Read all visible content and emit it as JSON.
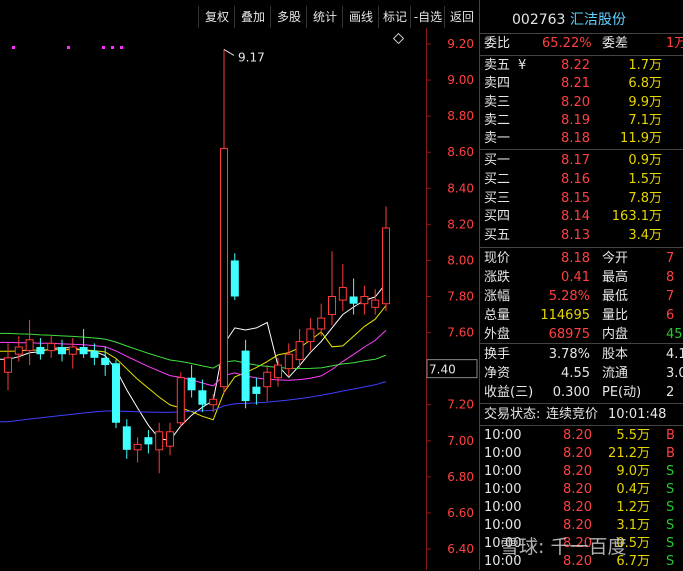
{
  "toolbar": {
    "buttons": [
      "复权",
      "叠加",
      "多股",
      "统计",
      "画线",
      "标记",
      "-自选",
      "返回"
    ]
  },
  "chart_data": {
    "type": "candlestick",
    "y_ticks": [
      "9.20",
      "9.00",
      "8.80",
      "8.60",
      "8.40",
      "8.20",
      "8.00",
      "7.80",
      "7.60",
      "7.40",
      "7.20",
      "7.00",
      "6.80",
      "6.60",
      "6.40"
    ],
    "ylim": [
      6.35,
      9.3
    ],
    "high_annotation": "9.17",
    "current_price_marker": "7.40",
    "candles": [
      {
        "o": 7.38,
        "c": 7.46,
        "h": 7.54,
        "l": 7.28,
        "up": true
      },
      {
        "o": 7.48,
        "c": 7.52,
        "h": 7.58,
        "l": 7.44,
        "up": true
      },
      {
        "o": 7.5,
        "c": 7.56,
        "h": 7.67,
        "l": 7.42,
        "up": true
      },
      {
        "o": 7.52,
        "c": 7.48,
        "h": 7.57,
        "l": 7.45,
        "up": false
      },
      {
        "o": 7.5,
        "c": 7.54,
        "h": 7.58,
        "l": 7.46,
        "up": true
      },
      {
        "o": 7.52,
        "c": 7.48,
        "h": 7.56,
        "l": 7.44,
        "up": false
      },
      {
        "o": 7.48,
        "c": 7.52,
        "h": 7.57,
        "l": 7.4,
        "up": true
      },
      {
        "o": 7.52,
        "c": 7.48,
        "h": 7.62,
        "l": 7.46,
        "up": false
      },
      {
        "o": 7.5,
        "c": 7.46,
        "h": 7.54,
        "l": 7.42,
        "up": false
      },
      {
        "o": 7.46,
        "c": 7.42,
        "h": 7.52,
        "l": 7.36,
        "up": false
      },
      {
        "o": 7.43,
        "c": 7.1,
        "h": 7.45,
        "l": 7.07,
        "up": false
      },
      {
        "o": 7.08,
        "c": 6.95,
        "h": 7.12,
        "l": 6.9,
        "up": false
      },
      {
        "o": 6.95,
        "c": 6.98,
        "h": 7.02,
        "l": 6.88,
        "up": true
      },
      {
        "o": 7.02,
        "c": 6.98,
        "h": 7.06,
        "l": 6.93,
        "up": false
      },
      {
        "o": 6.95,
        "c": 7.05,
        "h": 7.1,
        "l": 6.82,
        "up": true
      },
      {
        "o": 6.97,
        "c": 7.05,
        "h": 7.1,
        "l": 6.92,
        "up": true
      },
      {
        "o": 7.1,
        "c": 7.35,
        "h": 7.38,
        "l": 7.08,
        "up": true
      },
      {
        "o": 7.35,
        "c": 7.28,
        "h": 7.42,
        "l": 7.24,
        "up": false
      },
      {
        "o": 7.28,
        "c": 7.2,
        "h": 7.34,
        "l": 7.16,
        "up": false
      },
      {
        "o": 7.2,
        "c": 7.23,
        "h": 7.26,
        "l": 7.16,
        "up": true
      },
      {
        "o": 7.3,
        "c": 8.62,
        "h": 9.17,
        "l": 7.26,
        "up": true
      },
      {
        "o": 8.0,
        "c": 7.8,
        "h": 8.04,
        "l": 7.78,
        "up": false
      },
      {
        "o": 7.5,
        "c": 7.22,
        "h": 7.56,
        "l": 7.18,
        "up": false
      },
      {
        "o": 7.3,
        "c": 7.26,
        "h": 7.35,
        "l": 7.2,
        "up": false
      },
      {
        "o": 7.3,
        "c": 7.38,
        "h": 7.42,
        "l": 7.22,
        "up": true
      },
      {
        "o": 7.35,
        "c": 7.42,
        "h": 7.46,
        "l": 7.3,
        "up": true
      },
      {
        "o": 7.4,
        "c": 7.48,
        "h": 7.54,
        "l": 7.36,
        "up": true
      },
      {
        "o": 7.45,
        "c": 7.55,
        "h": 7.62,
        "l": 7.4,
        "up": true
      },
      {
        "o": 7.55,
        "c": 7.62,
        "h": 7.68,
        "l": 7.5,
        "up": true
      },
      {
        "o": 7.62,
        "c": 7.68,
        "h": 7.76,
        "l": 7.58,
        "up": true
      },
      {
        "o": 7.7,
        "c": 7.8,
        "h": 8.05,
        "l": 7.64,
        "up": true
      },
      {
        "o": 7.78,
        "c": 7.85,
        "h": 7.98,
        "l": 7.72,
        "up": true
      },
      {
        "o": 7.8,
        "c": 7.76,
        "h": 7.9,
        "l": 7.7,
        "up": false
      },
      {
        "o": 7.76,
        "c": 7.8,
        "h": 7.86,
        "l": 7.7,
        "up": true
      },
      {
        "o": 7.74,
        "c": 7.78,
        "h": 7.84,
        "l": 7.7,
        "up": true
      },
      {
        "o": 7.76,
        "c": 8.18,
        "h": 8.3,
        "l": 7.72,
        "up": true
      }
    ]
  },
  "colors": {
    "up": "#ff3b3b",
    "down": "#40ffff",
    "ma5": "#ffffff",
    "ma10": "#e6e600",
    "ma20": "#ff3fff",
    "ma30": "#40e040",
    "ma60": "#4040ff",
    "axis_text": "#ff4040"
  },
  "panel": {
    "code": "002763",
    "name": "汇洁股份",
    "weibi_label": "委比",
    "weibi_value": "65.22%",
    "weicha_label": "委差",
    "weicha_value": "1万",
    "sell": [
      {
        "label": "卖五",
        "price": "8.22",
        "vol": "1.7万",
        "extra": "¥"
      },
      {
        "label": "卖四",
        "price": "8.21",
        "vol": "6.8万",
        "extra": ""
      },
      {
        "label": "卖三",
        "price": "8.20",
        "vol": "9.9万",
        "extra": ""
      },
      {
        "label": "卖二",
        "price": "8.19",
        "vol": "7.1万",
        "extra": ""
      },
      {
        "label": "卖一",
        "price": "8.18",
        "vol": "11.9万",
        "extra": ""
      }
    ],
    "buy": [
      {
        "label": "买一",
        "price": "8.17",
        "vol": "0.9万"
      },
      {
        "label": "买二",
        "price": "8.16",
        "vol": "1.5万"
      },
      {
        "label": "买三",
        "price": "8.15",
        "vol": "7.8万"
      },
      {
        "label": "买四",
        "price": "8.14",
        "vol": "163.1万"
      },
      {
        "label": "买五",
        "price": "8.13",
        "vol": "3.4万"
      }
    ],
    "quote": [
      {
        "l1": "现价",
        "v1": "8.18",
        "c1": "red",
        "l2": "今开",
        "v2": "7",
        "c2": "red"
      },
      {
        "l1": "涨跌",
        "v1": "0.41",
        "c1": "red",
        "l2": "最高",
        "v2": "8",
        "c2": "red"
      },
      {
        "l1": "涨幅",
        "v1": "5.28%",
        "c1": "red",
        "l2": "最低",
        "v2": "7",
        "c2": "red"
      },
      {
        "l1": "总量",
        "v1": "114695",
        "c1": "yellow",
        "l2": "量比",
        "v2": "6",
        "c2": "red"
      },
      {
        "l1": "外盘",
        "v1": "68975",
        "c1": "red",
        "l2": "内盘",
        "v2": "45",
        "c2": "green"
      }
    ],
    "stats": [
      {
        "l1": "换手",
        "v1": "3.78%",
        "l2": "股本",
        "v2": "4.1"
      },
      {
        "l1": "净资",
        "v1": "4.55",
        "l2": "流通",
        "v2": "3.0"
      },
      {
        "l1": "收益(三)",
        "v1": "0.300",
        "l2": "PE(动)",
        "v2": "2"
      }
    ],
    "status_label": "交易状态:",
    "status_value": "连续竞价",
    "status_time": "10:01:48",
    "ticks": [
      {
        "time": "10:00",
        "price": "8.20",
        "vol": "5.5万",
        "side": "B"
      },
      {
        "time": "10:00",
        "price": "8.20",
        "vol": "21.2万",
        "side": "B"
      },
      {
        "time": "10:00",
        "price": "8.20",
        "vol": "9.0万",
        "side": "S"
      },
      {
        "time": "10:00",
        "price": "8.20",
        "vol": "0.4万",
        "side": "S"
      },
      {
        "time": "10:00",
        "price": "8.20",
        "vol": "1.2万",
        "side": "S"
      },
      {
        "time": "10:00",
        "price": "8.20",
        "vol": "3.1万",
        "side": "S"
      },
      {
        "time": "10:00",
        "price": "8.20",
        "vol": "0.5万",
        "side": "S"
      },
      {
        "time": "10:00",
        "price": "8.20",
        "vol": "6.7万",
        "side": "S"
      }
    ]
  },
  "watermark": "雪球: 千一百度"
}
